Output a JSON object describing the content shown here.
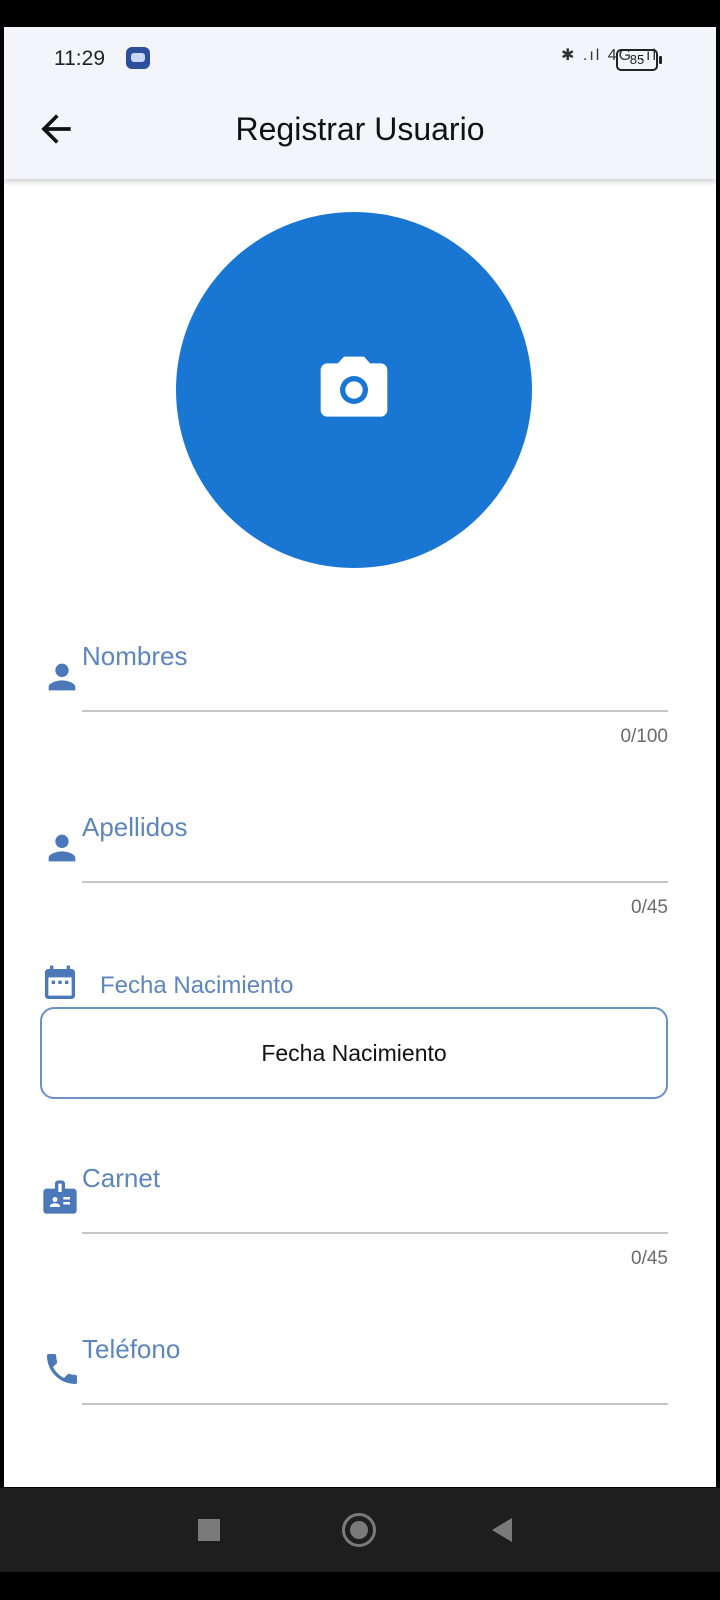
{
  "status_bar": {
    "time": "11:29",
    "battery": "85",
    "icons": "✱ .ıl  4G .ıl"
  },
  "header": {
    "title": "Registrar Usuario"
  },
  "photo": {
    "icon": "camera-icon"
  },
  "fields": {
    "nombres": {
      "label": "Nombres",
      "counter": "0/100",
      "icon": "person-icon"
    },
    "apellidos": {
      "label": "Apellidos",
      "counter": "0/45",
      "icon": "person-icon"
    },
    "fecha": {
      "label": "Fecha Nacimiento",
      "button_label": "Fecha Nacimiento",
      "icon": "calendar-icon"
    },
    "carnet": {
      "label": "Carnet",
      "counter": "0/45",
      "icon": "id-badge-icon"
    },
    "telefono": {
      "label": "Teléfono",
      "icon": "phone-icon"
    }
  },
  "colors": {
    "accent": "#1976d2",
    "label": "#5c86bd",
    "icon": "#4a78b8"
  },
  "nav": {
    "buttons": [
      "square-icon",
      "circle-icon",
      "triangle-back-icon"
    ]
  }
}
